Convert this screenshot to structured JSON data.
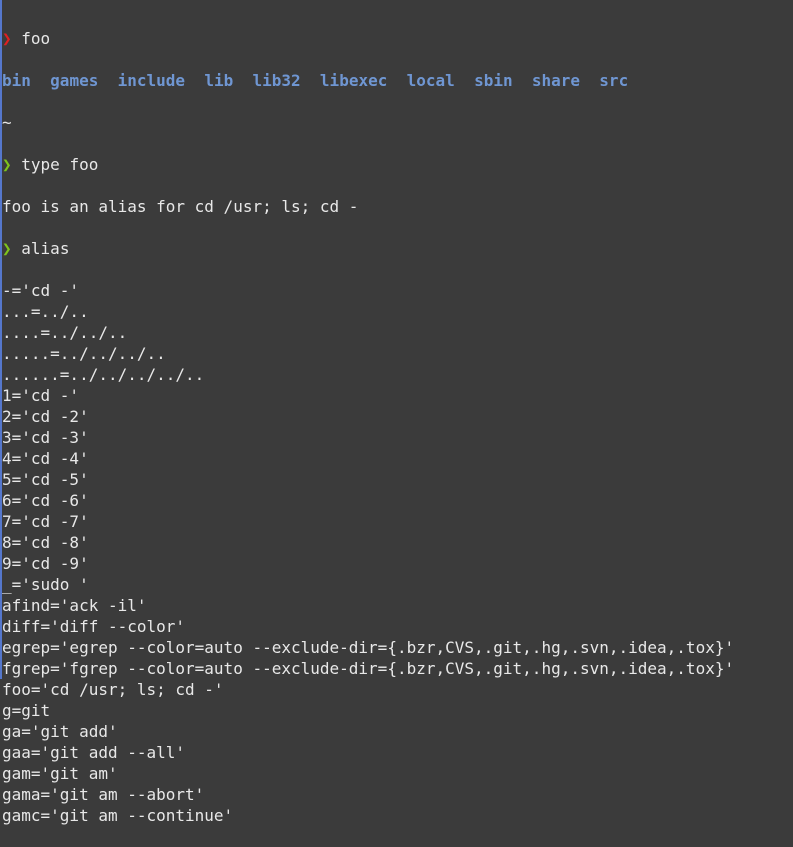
{
  "colors": {
    "background": "#3b3b3b",
    "text": "#e8e8e8",
    "prompt_error": "#e02020",
    "prompt_ok": "#7fc31c",
    "directory": "#6f96d2"
  },
  "prompt_glyph": "❯",
  "cmd1": "foo",
  "ls_entries": [
    "bin",
    "games",
    "include",
    "lib",
    "lib32",
    "libexec",
    "local",
    "sbin",
    "share",
    "src"
  ],
  "cwd": "~",
  "cmd2": "type foo",
  "type_output": "foo is an alias for cd /usr; ls; cd -",
  "cmd3": "alias",
  "alias_lines": [
    "-='cd -'",
    "...=../..",
    "....=../../..",
    ".....=../../../..",
    "......=../../../../..",
    "1='cd -'",
    "2='cd -2'",
    "3='cd -3'",
    "4='cd -4'",
    "5='cd -5'",
    "6='cd -6'",
    "7='cd -7'",
    "8='cd -8'",
    "9='cd -9'",
    "_='sudo '",
    "afind='ack -il'",
    "diff='diff --color'",
    "egrep='egrep --color=auto --exclude-dir={.bzr,CVS,.git,.hg,.svn,.idea,.tox}'",
    "fgrep='fgrep --color=auto --exclude-dir={.bzr,CVS,.git,.hg,.svn,.idea,.tox}'",
    "foo='cd /usr; ls; cd -'",
    "g=git",
    "ga='git add'",
    "gaa='git add --all'",
    "gam='git am'",
    "gama='git am --abort'",
    "gamc='git am --continue'"
  ]
}
